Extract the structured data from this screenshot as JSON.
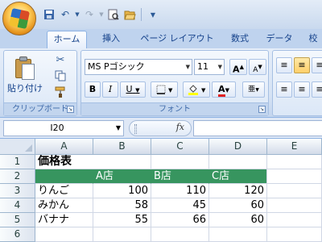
{
  "qat": {
    "icons": [
      "save-icon",
      "undo-icon",
      "redo-icon",
      "print-preview-icon",
      "open-folder-icon",
      "customize-icon"
    ]
  },
  "tabs": [
    "ホーム",
    "挿入",
    "ページ レイアウト",
    "数式",
    "データ",
    "校"
  ],
  "ribbon": {
    "clipboard": {
      "paste_label": "貼り付け",
      "group_label": "クリップボード"
    },
    "font": {
      "font_name": "MS Pゴシック",
      "font_size": "11",
      "grow_label": "A",
      "shrink_label": "A",
      "bold": "B",
      "italic": "I",
      "underline": "U",
      "font_color_label": "A",
      "group_label": "フォント"
    }
  },
  "formula_bar": {
    "name_box": "I20",
    "fx": "fx",
    "formula": ""
  },
  "grid": {
    "columns": [
      "A",
      "B",
      "C",
      "D",
      "E"
    ],
    "rows": [
      "1",
      "2",
      "3",
      "4",
      "5",
      "6"
    ],
    "title": "価格表",
    "headers": [
      "",
      "A店",
      "B店",
      "C店"
    ],
    "data": [
      {
        "item": "りんご",
        "a": "100",
        "b": "110",
        "c": "120"
      },
      {
        "item": "みかん",
        "a": "58",
        "b": "45",
        "c": "60"
      },
      {
        "item": "バナナ",
        "a": "55",
        "b": "66",
        "c": "60"
      }
    ]
  },
  "colors": {
    "header_fill": "#37955f",
    "header_text": "#ffffff",
    "ribbon_bg": "#dfe8f6"
  }
}
